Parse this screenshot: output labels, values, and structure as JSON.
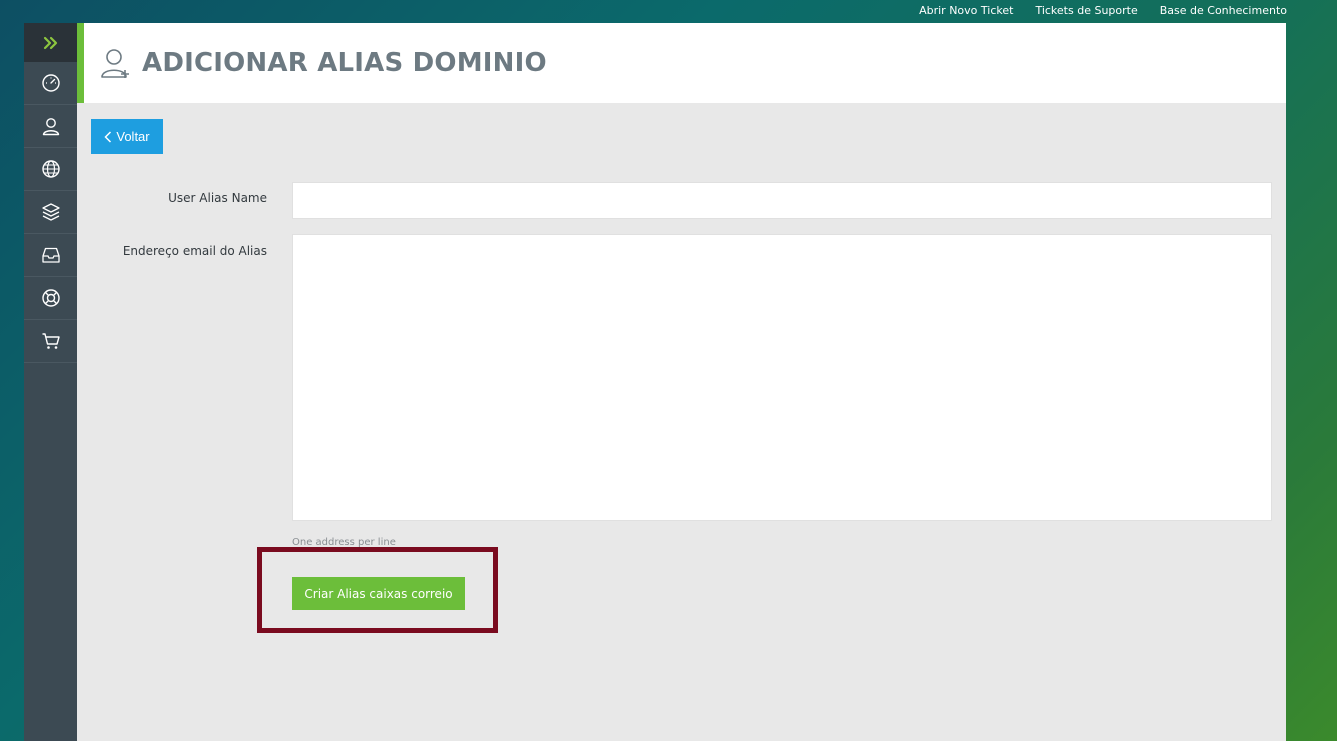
{
  "topnav": {
    "items": [
      "Abrir Novo Ticket",
      "Tickets de Suporte",
      "Base de Conhecimento"
    ]
  },
  "sidebar": {
    "toggle_icon": "double-chevron-right-icon",
    "items": [
      {
        "icon": "speedometer-icon"
      },
      {
        "icon": "user-icon"
      },
      {
        "icon": "globe-icon"
      },
      {
        "icon": "layers-icon"
      },
      {
        "icon": "inbox-icon"
      },
      {
        "icon": "lifebuoy-icon"
      },
      {
        "icon": "cart-icon"
      }
    ]
  },
  "page": {
    "title": "ADICIONAR ALIAS DOMINIO",
    "title_icon": "user-add-icon"
  },
  "back_button": {
    "label": "Voltar"
  },
  "form": {
    "alias_name_label": "User Alias Name",
    "alias_name_value": "",
    "alias_email_label": "Endereço email do Alias",
    "alias_email_value": "",
    "alias_email_help": "One address per line",
    "submit_label": "Criar Alias caixas correio"
  },
  "colors": {
    "accent_green": "#6cbe3a",
    "accent_blue": "#1e9ee0",
    "sidebar_bg": "#3c4a53",
    "highlight_border": "#7a0b1f"
  }
}
